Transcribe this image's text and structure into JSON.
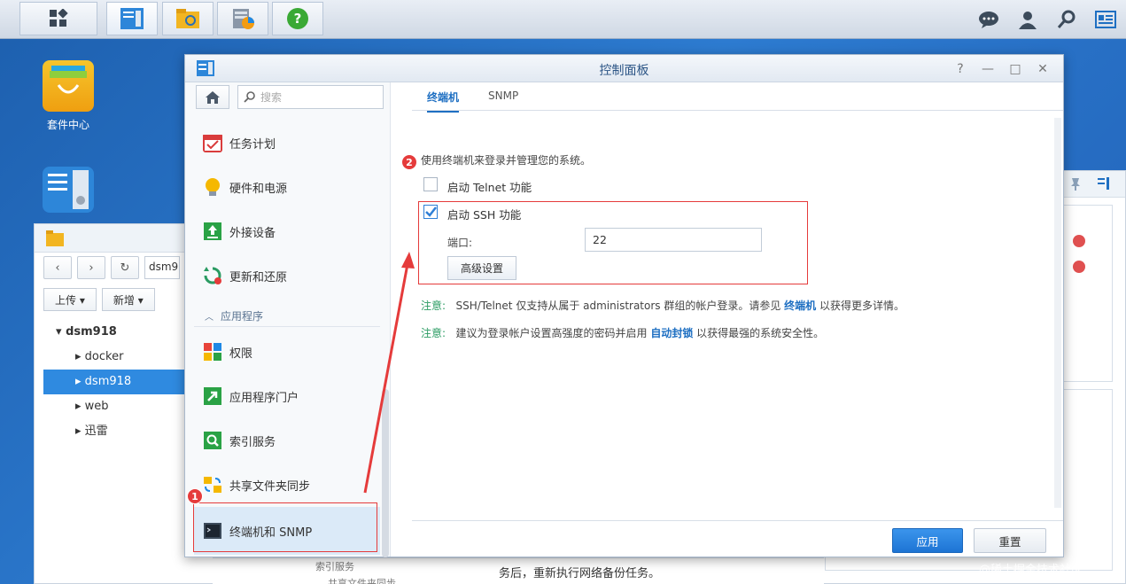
{
  "desktop": {
    "icons": [
      {
        "label": "套件中心"
      },
      {
        "label": ""
      }
    ],
    "watermark": "@稀土掘金技术社区"
  },
  "file_station": {
    "path": "dsm9",
    "upload_label": "上传",
    "new_label": "新增",
    "root": "dsm918",
    "tree": [
      "docker",
      "dsm918",
      "web",
      "迅雷"
    ],
    "selected": "dsm918"
  },
  "background_texts": {
    "line1": "务后，重新执行网络备份任务。",
    "tree_item_1": "索引服务",
    "tree_item_2": "共享文件夹同步"
  },
  "control_panel": {
    "title": "控制面板",
    "search_placeholder": "搜索",
    "sidebar": {
      "items": [
        {
          "label": "任务计划",
          "icon": "task-scheduler-icon",
          "color": "#d93c3c"
        },
        {
          "label": "硬件和电源",
          "icon": "bulb-icon",
          "color": "#f0b400"
        },
        {
          "label": "外接设备",
          "icon": "external-device-icon",
          "color": "#2aa245"
        },
        {
          "label": "更新和还原",
          "icon": "update-restore-icon",
          "color": "#2a9b62"
        }
      ],
      "section_label": "应用程序",
      "app_items": [
        {
          "label": "权限",
          "icon": "privileges-icon",
          "color": "#e8443a"
        },
        {
          "label": "应用程序门户",
          "icon": "app-portal-icon",
          "color": "#2aa245"
        },
        {
          "label": "索引服务",
          "icon": "indexing-icon",
          "color": "#2aa245"
        },
        {
          "label": "共享文件夹同步",
          "icon": "shared-folder-sync-icon",
          "color": "#f0b400"
        },
        {
          "label": "终端机和 SNMP",
          "icon": "terminal-icon",
          "color": "#333333"
        }
      ],
      "active": "终端机和 SNMP"
    },
    "tabs": [
      {
        "label": "终端机",
        "active": true
      },
      {
        "label": "SNMP",
        "active": false
      }
    ],
    "description": "使用终端机来登录并管理您的系统。",
    "telnet": {
      "label": "启动 Telnet 功能",
      "checked": false
    },
    "ssh": {
      "label": "启动 SSH 功能",
      "checked": true
    },
    "port_label": "端口:",
    "port_value": "22",
    "advanced_button": "高级设置",
    "notes": [
      {
        "prefix": "注意:",
        "text": "SSH/Telnet 仅支持从属于 administrators 群组的帐户登录。请参见 ",
        "link": "终端机",
        "suffix": " 以获得更多详情。"
      },
      {
        "prefix": "注意:",
        "text": "建议为登录帐户设置高强度的密码并启用 ",
        "link": "自动封锁",
        "suffix": " 以获得最强的系统安全性。"
      }
    ],
    "apply_button": "应用",
    "reset_button": "重置"
  },
  "annotations": {
    "badge1": "1",
    "badge2": "2",
    "accent_color": "#e53b3b"
  }
}
